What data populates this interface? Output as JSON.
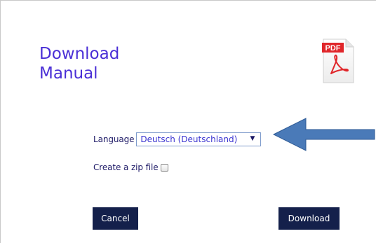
{
  "dialog": {
    "title_line1": "Download",
    "title_line2": "Manual",
    "pdf_icon_text": "PDF"
  },
  "form": {
    "language_label": "Language",
    "language_value": "Deutsch (Deutschland)",
    "language_caret": "▼",
    "zip_label": "Create a zip file",
    "zip_checked": false
  },
  "buttons": {
    "cancel_label": "Cancel",
    "download_label": "Download"
  },
  "colors": {
    "title": "#4a2fd6",
    "label": "#1d1966",
    "button_bg": "#14204b",
    "arrow": "#4a7ab8",
    "pdf_red": "#e0262a"
  },
  "icons": {
    "pdf": "pdf-file-icon",
    "arrow": "left-arrow-annotation-icon"
  }
}
